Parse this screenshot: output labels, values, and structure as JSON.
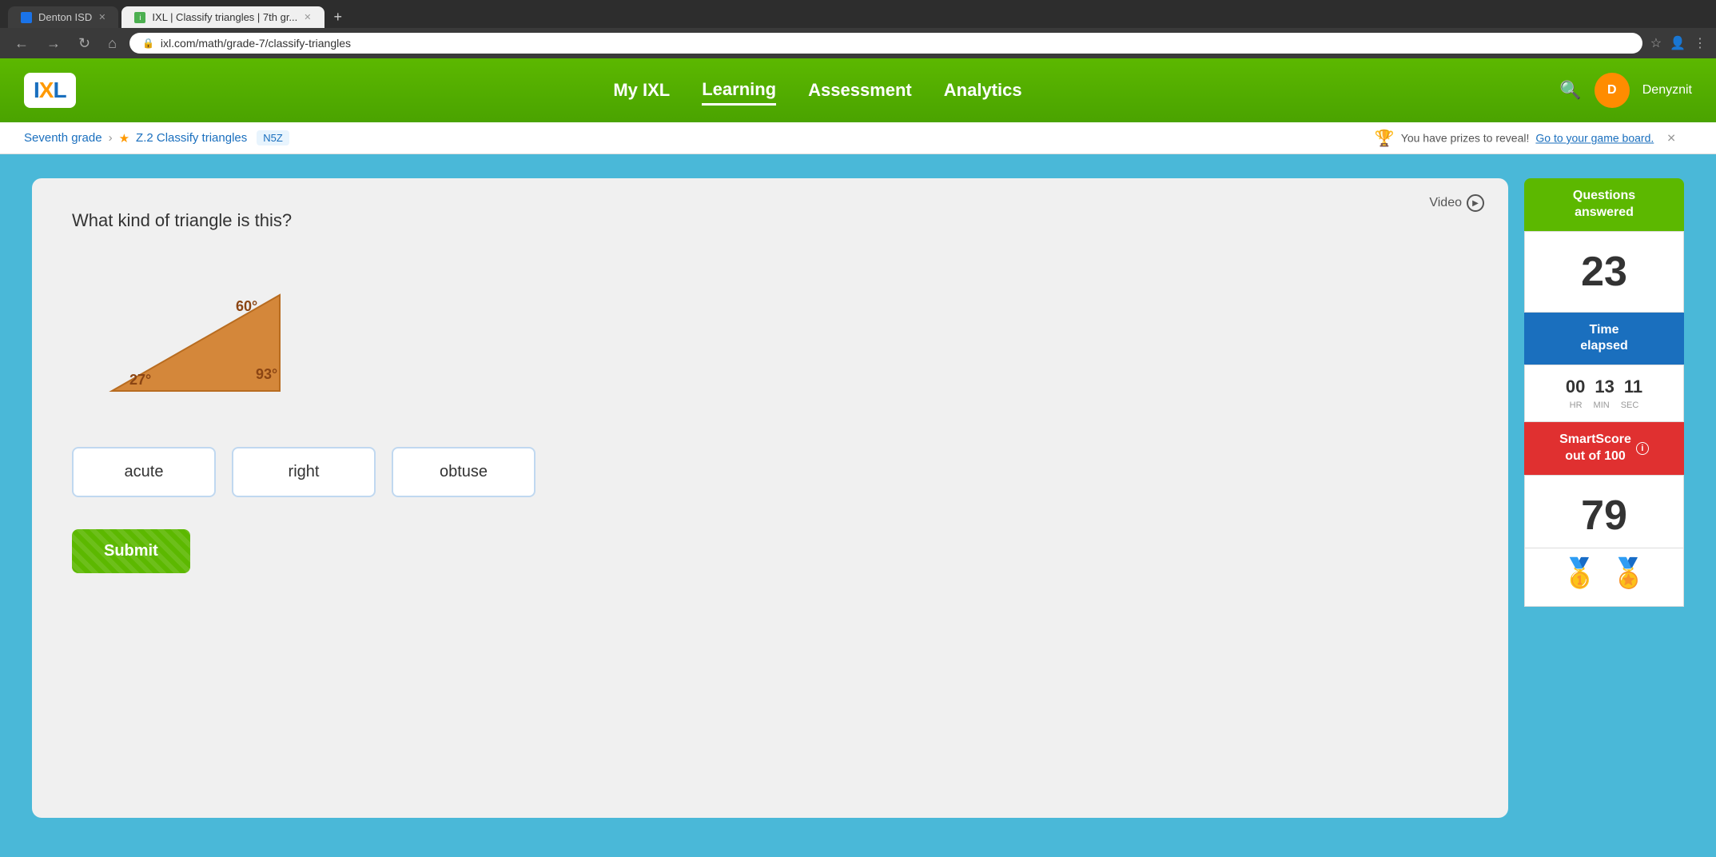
{
  "browser": {
    "tabs": [
      {
        "label": "Denton ISD",
        "active": false,
        "favicon": "blue"
      },
      {
        "label": "IXL | Classify triangles | 7th gr...",
        "active": true,
        "favicon": "green"
      }
    ],
    "address": "ixl.com/math/grade-7/classify-triangles",
    "new_tab_label": "+"
  },
  "header": {
    "logo_text": "IXL",
    "logo_i": "I",
    "nav_items": [
      {
        "label": "My IXL",
        "active": false
      },
      {
        "label": "Learning",
        "active": true
      },
      {
        "label": "Assessment",
        "active": false
      },
      {
        "label": "Analytics",
        "active": false
      }
    ],
    "user_initials": "D",
    "user_name": "Denyznit"
  },
  "breadcrumb": {
    "parent": "Seventh grade",
    "skill_label": "Z.2 Classify triangles",
    "skill_code": "N5Z"
  },
  "prize_banner": {
    "text": "You have prizes to reveal!",
    "link": "Go to your game board."
  },
  "question": {
    "text": "What kind of triangle is this?",
    "angle1": "60°",
    "angle2": "27°",
    "angle3": "93°",
    "video_label": "Video"
  },
  "answers": [
    {
      "label": "acute"
    },
    {
      "label": "right"
    },
    {
      "label": "obtuse"
    }
  ],
  "submit_label": "Submit",
  "sidebar": {
    "questions_answered_label": "Questions\nanswered",
    "questions_count": "23",
    "time_elapsed_label": "Time\nelapsed",
    "time": {
      "hr": "00",
      "min": "13",
      "sec": "11",
      "hr_label": "HR",
      "min_label": "MIN",
      "sec_label": "SEC"
    },
    "smart_score_label": "SmartScore",
    "smart_score_sublabel": "out of 100",
    "smart_score_value": "79"
  }
}
